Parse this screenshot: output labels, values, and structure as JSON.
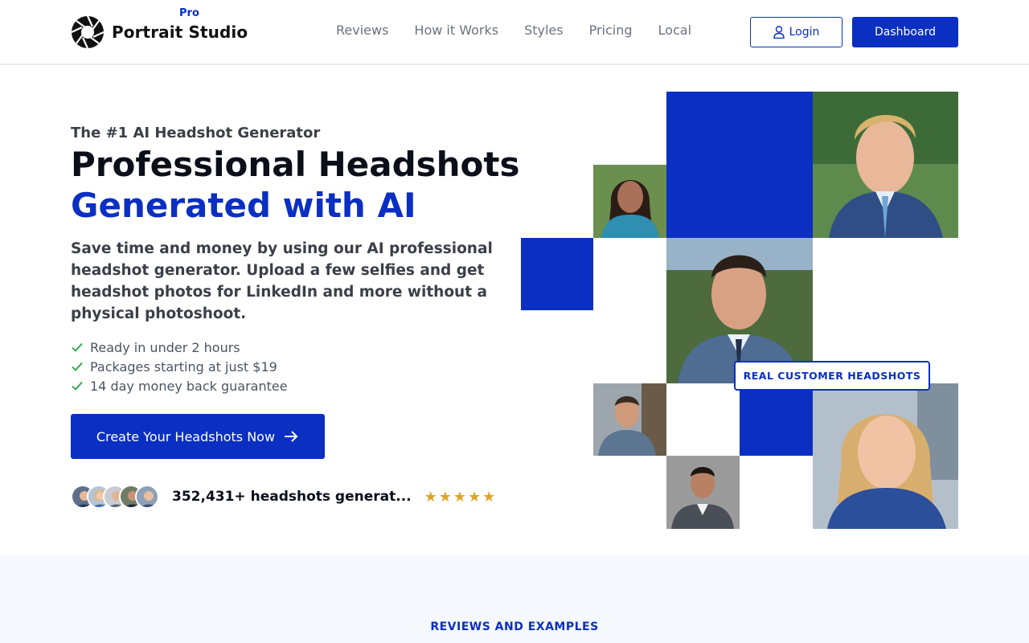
{
  "header": {
    "brand_name": "Portrait Studio",
    "brand_badge": "Pro",
    "nav": [
      {
        "label": "Reviews"
      },
      {
        "label": "How it Works"
      },
      {
        "label": "Styles"
      },
      {
        "label": "Pricing"
      },
      {
        "label": "Local"
      }
    ],
    "login_label": "Login",
    "dashboard_label": "Dashboard"
  },
  "hero": {
    "eyebrow": "The #1 AI Headshot Generator",
    "headline_line1": "Professional Headshots",
    "headline_line2": "Generated with AI",
    "description": "Save time and money by using our AI professional headshot generator. Upload a few selfies and get headshot photos for LinkedIn and more without a physical photoshoot.",
    "features": [
      "Ready in under 2 hours",
      "Packages starting at just $19",
      "14 day money back guarantee"
    ],
    "cta_label": "Create Your Headshots Now",
    "social_proof": "352,431+ headshots generat...",
    "stars": "★★★★★",
    "rating_stars": 5,
    "badge_label": "REAL CUSTOMER HEADSHOTS"
  },
  "reviews_section": {
    "eyebrow": "REVIEWS AND EXAMPLES"
  },
  "colors": {
    "brand_blue": "#0a2fc2",
    "star_gold": "#e0a423",
    "check_green": "#22a447"
  }
}
